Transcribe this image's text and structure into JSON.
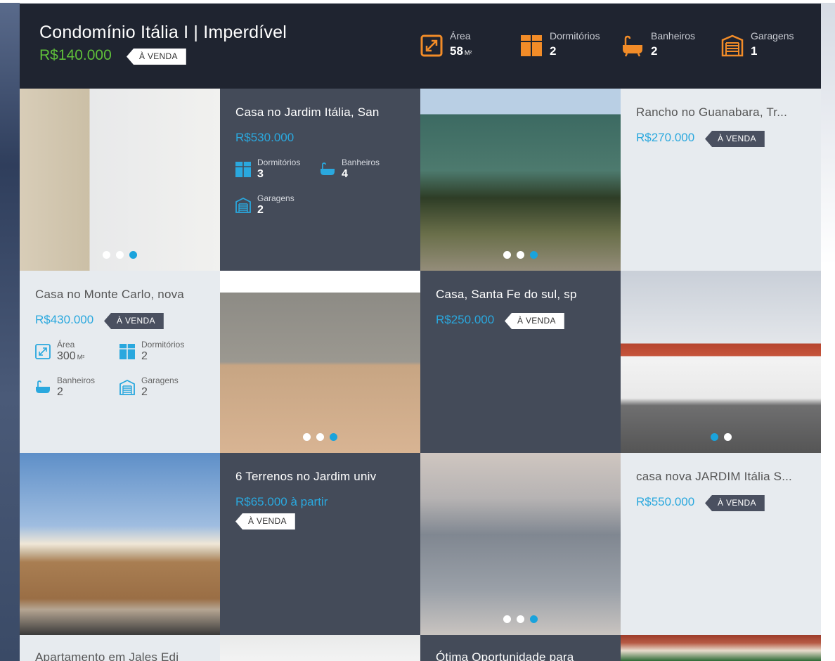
{
  "header": {
    "title": "Condomínio Itália I | Imperdível",
    "price": "R$140.000",
    "tag": "À VENDA",
    "stats": [
      {
        "label": "Área",
        "value": "58",
        "unit": "M²",
        "icon": "area-icon"
      },
      {
        "label": "Dormitórios",
        "value": "2",
        "icon": "bed-icon"
      },
      {
        "label": "Banheiros",
        "value": "2",
        "icon": "bathtub-icon"
      },
      {
        "label": "Garagens",
        "value": "1",
        "icon": "garage-icon"
      }
    ]
  },
  "cards": {
    "c1": {
      "title": "Casa no Jardim Itália, San",
      "price": "R$530.000",
      "stats": [
        {
          "label": "Dormitórios",
          "value": "3"
        },
        {
          "label": "Banheiros",
          "value": "4"
        },
        {
          "label": "Garagens",
          "value": "2"
        }
      ]
    },
    "c2": {
      "title": "Rancho no Guanabara, Tr...",
      "price": "R$270.000",
      "tag": "À VENDA"
    },
    "c3": {
      "title": "Casa no Monte Carlo, nova",
      "price": "R$430.000",
      "tag": "À VENDA",
      "stats": [
        {
          "label": "Área",
          "value": "300",
          "unit": "M²"
        },
        {
          "label": "Dormitórios",
          "value": "2"
        },
        {
          "label": "Banheiros",
          "value": "2"
        },
        {
          "label": "Garagens",
          "value": "2"
        }
      ]
    },
    "c4": {
      "title": "Casa, Santa Fe do sul, sp",
      "price": "R$250.000",
      "tag": "À VENDA"
    },
    "c5": {
      "title": "6 Terrenos no Jardim univ",
      "price": "R$65.000 à partir",
      "tag": "À VENDA"
    },
    "c6": {
      "title": "casa nova JARDIM Itália S...",
      "price": "R$550.000",
      "tag": "À VENDA"
    },
    "c7": {
      "title": "Apartamento em Jales Edi"
    },
    "c8": {
      "title": "Ótima Oportunidade para"
    }
  },
  "carousels": {
    "bathroom": 3,
    "bathroom_active": 2,
    "pool": 3,
    "pool_active": 2,
    "patio": 3,
    "patio_active": 2,
    "house": 2,
    "house_active": 0,
    "glass": 3,
    "glass_active": 2
  },
  "colors": {
    "accent_orange": "#f28c28",
    "accent_blue": "#2aa8de",
    "price_green": "#5fbf3a"
  }
}
